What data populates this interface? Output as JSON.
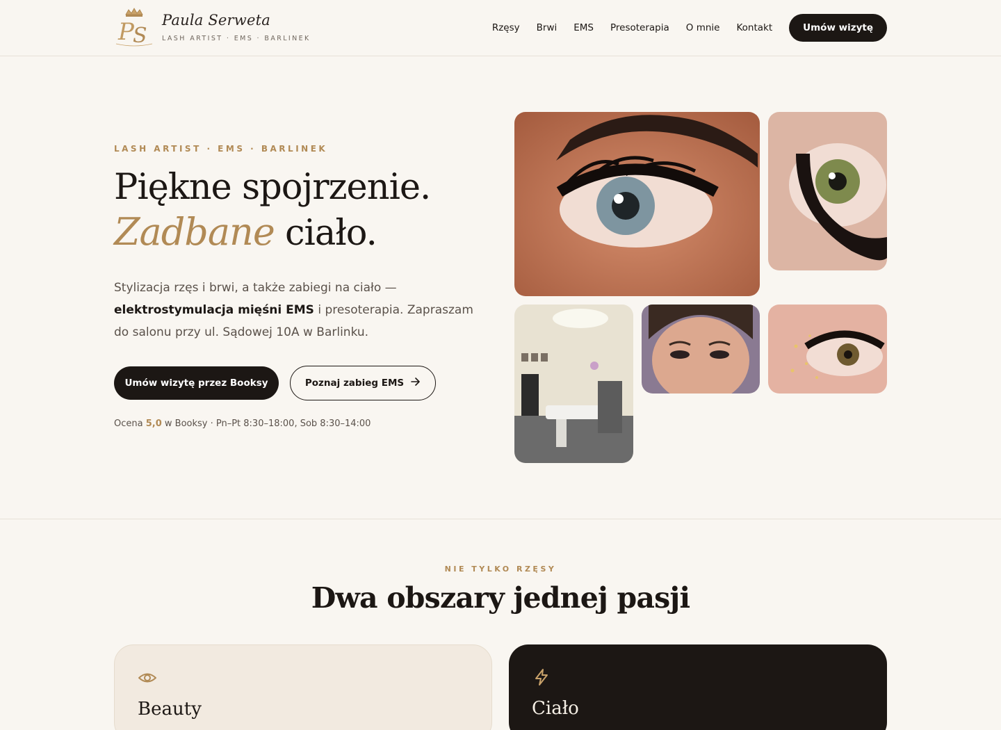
{
  "colors": {
    "background": "#f9f6f1",
    "accent_gold": "#b18a55",
    "ink": "#1c1714",
    "muted": "#5a514a",
    "card_light": "#f2eae0",
    "card_dark": "#1c1714"
  },
  "header": {
    "logo_name": "Paula Serweta",
    "logo_tagline": "LASH ARTIST · EMS · BARLINEK",
    "logo_icon": "ps-crown-monogram-icon",
    "nav": [
      {
        "label": "Rzęsy"
      },
      {
        "label": "Brwi"
      },
      {
        "label": "EMS"
      },
      {
        "label": "Presoterapia"
      },
      {
        "label": "O mnie"
      },
      {
        "label": "Kontakt"
      }
    ],
    "cta_label": "Umów wizytę"
  },
  "hero": {
    "eyebrow": "LASH ARTIST · EMS · BARLINEK",
    "title_line1": "Piękne spojrzenie.",
    "title_accent": "Zadbane",
    "title_line2_rest": " ciało.",
    "desc_part1": "Stylizacja rzęs i brwi, a także zabiegi na ciało — ",
    "desc_bold": "elektrostymulacja mięśni EMS",
    "desc_part2": " i presoterapia. Zapraszam do salonu przy ul. Sądowej 10A w Barlinku.",
    "btn_primary": "Umów wizytę przez Booksy",
    "btn_secondary": "Poznaj zabieg EMS",
    "btn_secondary_icon": "arrow-right-icon",
    "meta_prefix": "Ocena ",
    "meta_rating": "5,0",
    "meta_suffix": " w Booksy · Pn–Pt 8:30–18:00, Sob 8:30–14:00"
  },
  "gallery": {
    "photos": [
      {
        "subject": "lash-closeup-brow"
      },
      {
        "subject": "lash-closeup-green-eye"
      },
      {
        "subject": "salon-interior"
      },
      {
        "subject": "client-portrait"
      },
      {
        "subject": "lash-gold-glitter"
      }
    ]
  },
  "section_two": {
    "eyebrow": "NIE TYLKO RZĘSY",
    "title": "Dwa obszary jednej pasji",
    "cards": [
      {
        "title": "Beauty",
        "icon": "eye-icon"
      },
      {
        "title": "Ciało",
        "icon": "lightning-icon"
      }
    ]
  }
}
